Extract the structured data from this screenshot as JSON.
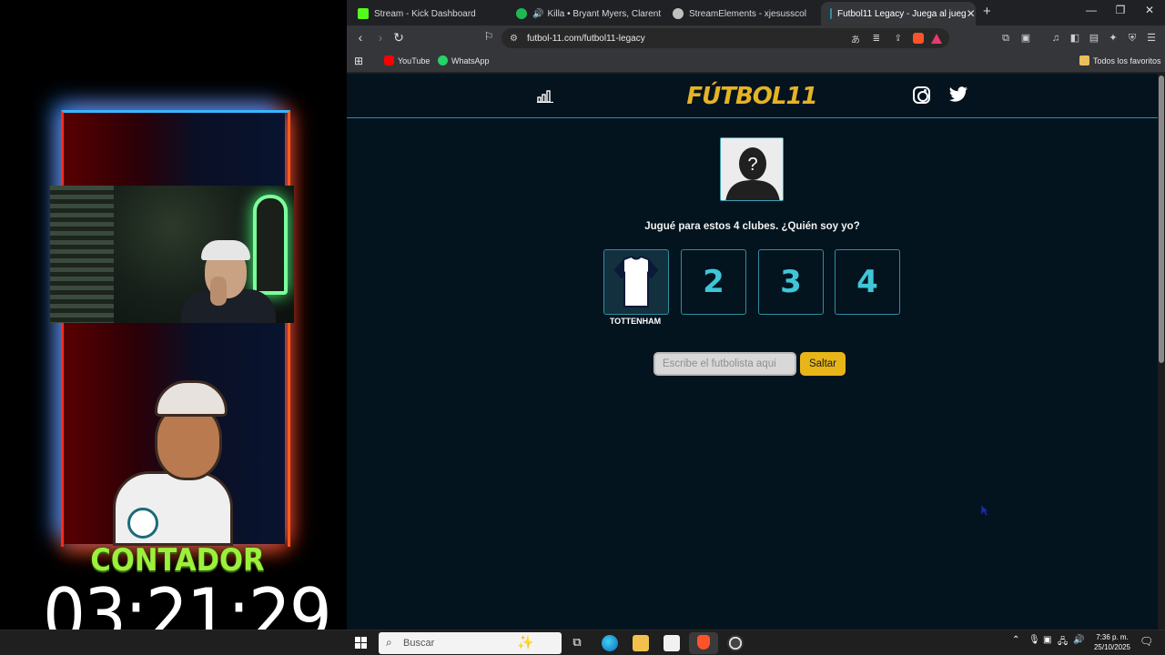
{
  "overlay": {
    "counter_label": "CONTADOR",
    "counter_time": "03:21:29"
  },
  "browser": {
    "tabs": [
      {
        "label": "Stream - Kick Dashboard",
        "icon": "kick-icon",
        "color": "#53fc18"
      },
      {
        "label": "Killa • Bryant Myers, Clarent",
        "icon": "spotify-icon",
        "color": "#1db954"
      },
      {
        "label": "StreamElements - xjesusscol",
        "icon": "streamelements-icon",
        "color": "#c0c0c0"
      },
      {
        "label": "Futbol11 Legacy - Juega al jueg",
        "icon": "futbol11-icon",
        "color": "#0c3d3d"
      }
    ],
    "url": "futbol-11.com/futbol11-legacy",
    "bookmarks": [
      {
        "label": "YouTube",
        "color": "#ff0000"
      },
      {
        "label": "WhatsApp",
        "color": "#25d366"
      }
    ],
    "all_favorites": "Todos los favoritos"
  },
  "page": {
    "logo": "FÚTBOL11",
    "question": "Jugué para estos 4 clubes. ¿Quién soy yo?",
    "clubs": [
      {
        "label": "",
        "name": "TOTTENHAM",
        "revealed": true
      },
      {
        "label": "2"
      },
      {
        "label": "3"
      },
      {
        "label": "4"
      }
    ],
    "input_placeholder": "Escribe el futbolista aqui",
    "skip_label": "Saltar",
    "accent_color": "#e5b325",
    "club_color": "#3fc5d7"
  },
  "taskbar": {
    "search_placeholder": "Buscar",
    "time": "7:36 p. m.",
    "date": "25/10/2025"
  }
}
